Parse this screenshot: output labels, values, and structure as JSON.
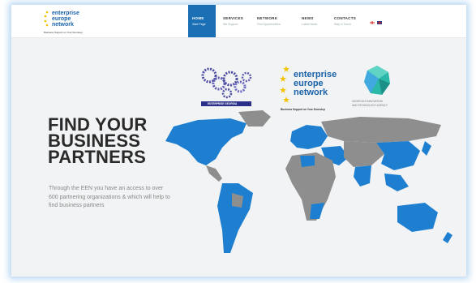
{
  "brand": {
    "logo_line1": "enterprise",
    "logo_line2": "europe",
    "logo_line3": "network",
    "tagline": "Business Support on Your Doorstep"
  },
  "nav": {
    "items": [
      {
        "title": "HOME",
        "subtitle": "Start Page",
        "active": true
      },
      {
        "title": "SERVICES",
        "subtitle": "We Support",
        "active": false
      },
      {
        "title": "NETWORK",
        "subtitle": "Find Opportunities",
        "active": false
      },
      {
        "title": "NEWS",
        "subtitle": "Latest News",
        "active": false
      },
      {
        "title": "CONTACTS",
        "subtitle": "Stay in Touch",
        "active": false
      }
    ]
  },
  "partners": {
    "enterprise_georgia_label": "ENTERPRISE GEORGIA",
    "een_line1": "enterprise",
    "een_line2": "europe",
    "een_line3": "network",
    "een_tagline": "Business Support on Your Doorstep",
    "gita_line1": "GEORGIA'S INNOVATION",
    "gita_line2": "AND TECHNOLOGY AGENCY"
  },
  "hero": {
    "headline_line1": "FIND YOUR",
    "headline_line2": "BUSINESS",
    "headline_line3": "PARTNERS",
    "subtext": "Through the EEN you have an access to over 600 partnering organizations & which will help to find business partners"
  },
  "colors": {
    "brand_blue": "#1a6fb5",
    "map_blue": "#1e7fd0",
    "map_gray": "#8e8e8e",
    "star_yellow": "#f2c200"
  }
}
